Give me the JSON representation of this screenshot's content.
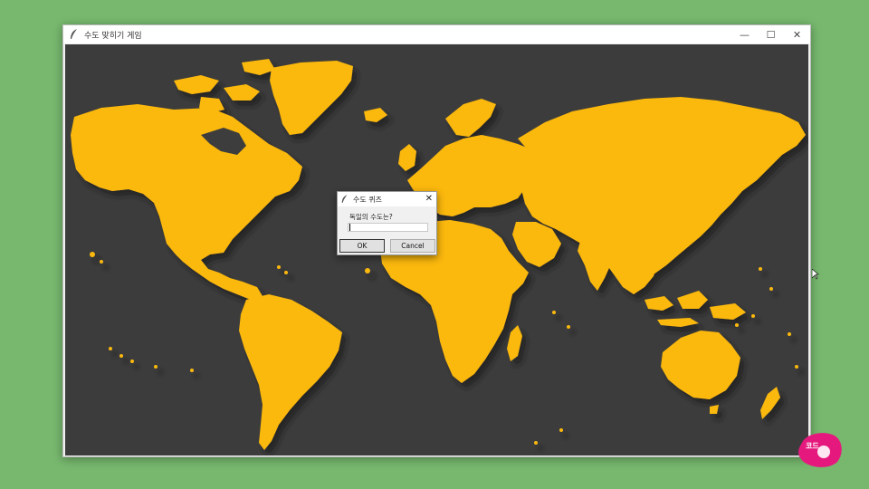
{
  "window": {
    "title": "수도 맞히기 게임",
    "app_icon": "feather-icon",
    "controls": {
      "minimize": "—",
      "maximize": "☐",
      "close": "✕"
    }
  },
  "map": {
    "background_color": "#3c3c3c",
    "land_color": "#fbb80b"
  },
  "dialog": {
    "title": "수도 퀴즈",
    "prompt": "독일의 수도는?",
    "input_value": "",
    "ok_label": "OK",
    "cancel_label": "Cancel",
    "close_glyph": "✕"
  },
  "desktop": {
    "background_color": "#77b86e"
  }
}
